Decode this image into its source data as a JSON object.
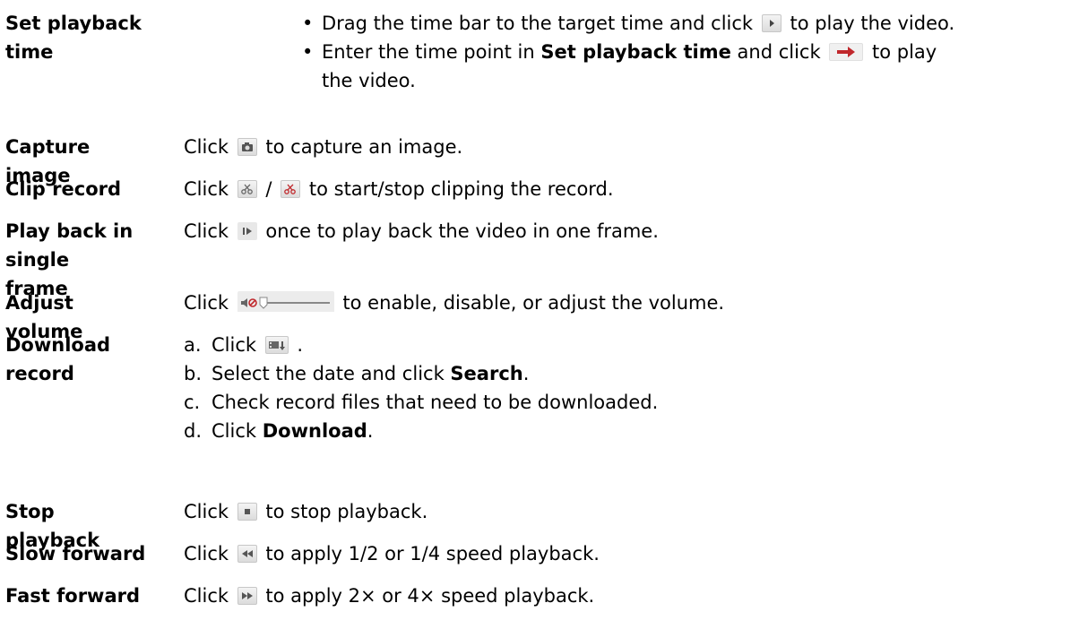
{
  "rows": [
    {
      "term": "Set playback time",
      "bullets": [
        {
          "pre": "Drag the time bar to the target time and click",
          "post": "to play the video."
        },
        {
          "pre": "Enter the time point in",
          "bold": "Set playback time",
          "mid": "and click",
          "post": "to play",
          "post2": "the video."
        }
      ]
    },
    {
      "term": "Capture image",
      "pre": "Click",
      "post": "to capture an image."
    },
    {
      "term": "Clip record",
      "pre": "Click",
      "sep": "/",
      "post": "to start/stop clipping the record."
    },
    {
      "term": "Play back in single",
      "term2": "frame",
      "pre": "Click",
      "post": "once to play back the video in one frame."
    },
    {
      "term": "Adjust volume",
      "pre": "Click",
      "post": "to enable, disable, or adjust the volume."
    },
    {
      "term": "Download record",
      "steps": [
        {
          "letter": "a.",
          "pre": "Click",
          "post": "."
        },
        {
          "letter": "b.",
          "pre": "Select the date and click",
          "bold": "Search",
          "post": "."
        },
        {
          "letter": "c.",
          "pre": "Check record files that need to be downloaded."
        },
        {
          "letter": "d.",
          "pre": "Click",
          "bold": "Download",
          "post": "."
        }
      ]
    },
    {
      "term": "Stop playback",
      "pre": "Click",
      "post": "to stop playback."
    },
    {
      "term": "Slow forward",
      "pre": "Click",
      "post": "to apply 1/2 or 1/4 speed playback."
    },
    {
      "term": "Fast forward",
      "pre": "Click",
      "post": "to apply 2× or 4× speed playback."
    }
  ],
  "bullet_char": "•",
  "icons": {
    "play": "play-icon",
    "go_arrow": "go-arrow-icon",
    "camera": "camera-icon",
    "clip_start": "clip-start-icon",
    "clip_stop": "clip-stop-icon",
    "single_frame": "single-frame-icon",
    "volume": "volume-slider-icon",
    "download": "download-icon",
    "stop": "stop-icon",
    "slow": "slow-forward-icon",
    "fast": "fast-forward-icon"
  },
  "colors": {
    "text": "#000000",
    "arrow_red": "#c0282c",
    "clip_red": "#c0282c",
    "icon_grey": "#555555"
  }
}
